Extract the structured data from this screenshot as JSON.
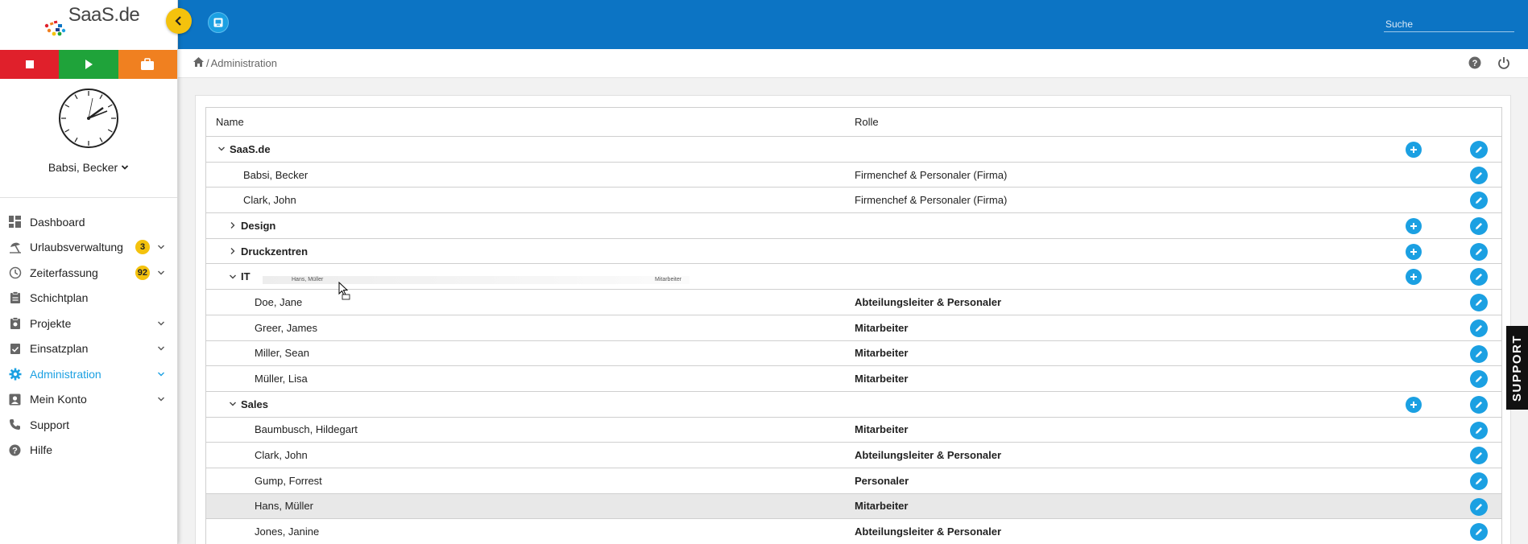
{
  "brand": {
    "name": "SaaS.de"
  },
  "timer": {
    "stop_label": "Stop",
    "play_label": "Start",
    "break_label": "Pause"
  },
  "user": {
    "name": "Babsi, Becker"
  },
  "nav": {
    "items": [
      {
        "label": "Dashboard",
        "icon": "dashboard-icon"
      },
      {
        "label": "Urlaubsverwaltung",
        "icon": "vacation-icon",
        "badge": "3"
      },
      {
        "label": "Zeiterfassung",
        "icon": "clock-icon",
        "badge": "92"
      },
      {
        "label": "Schichtplan",
        "icon": "clipboard-icon"
      },
      {
        "label": "Projekte",
        "icon": "briefcase-icon"
      },
      {
        "label": "Einsatzplan",
        "icon": "checklist-icon"
      },
      {
        "label": "Administration",
        "icon": "gear-icon"
      },
      {
        "label": "Mein Konto",
        "icon": "account-icon"
      },
      {
        "label": "Support",
        "icon": "phone-icon"
      },
      {
        "label": "Hilfe",
        "icon": "help-icon"
      }
    ]
  },
  "search": {
    "placeholder": "Suche"
  },
  "breadcrumb": {
    "separator": "/",
    "current": "Administration"
  },
  "table": {
    "headers": {
      "name": "Name",
      "role": "Rolle"
    },
    "rows": [
      {
        "name": "SaaS.de",
        "role": ""
      },
      {
        "name": "Babsi, Becker",
        "role": "Firmenchef & Personaler (Firma)"
      },
      {
        "name": "Clark, John",
        "role": "Firmenchef & Personaler (Firma)"
      },
      {
        "name": "Design",
        "role": ""
      },
      {
        "name": "Druckzentren",
        "role": ""
      },
      {
        "name": "IT",
        "role": ""
      },
      {
        "name": "Doe, Jane",
        "role": "Abteilungsleiter & Personaler"
      },
      {
        "name": "Greer, James",
        "role": "Mitarbeiter"
      },
      {
        "name": "Miller, Sean",
        "role": "Mitarbeiter"
      },
      {
        "name": "Müller, Lisa",
        "role": "Mitarbeiter"
      },
      {
        "name": "Sales",
        "role": ""
      },
      {
        "name": "Baumbusch, Hildegart",
        "role": "Mitarbeiter"
      },
      {
        "name": "Clark, John",
        "role": "Abteilungsleiter & Personaler"
      },
      {
        "name": "Gump, Forrest",
        "role": "Personaler"
      },
      {
        "name": "Hans, Müller",
        "role": "Mitarbeiter"
      },
      {
        "name": "Jones, Janine",
        "role": "Abteilungsleiter & Personaler"
      }
    ]
  },
  "drag_ghost": {
    "name": "Hans, Müller",
    "role": "Mitarbeiter"
  },
  "support_tab": {
    "label": "SUPPORT"
  },
  "colors": {
    "primary": "#0c74c4",
    "accent": "#1ba0e2",
    "badge": "#f4c20d",
    "stop": "#e0202b",
    "play": "#1fa33a",
    "pause": "#f08020"
  }
}
